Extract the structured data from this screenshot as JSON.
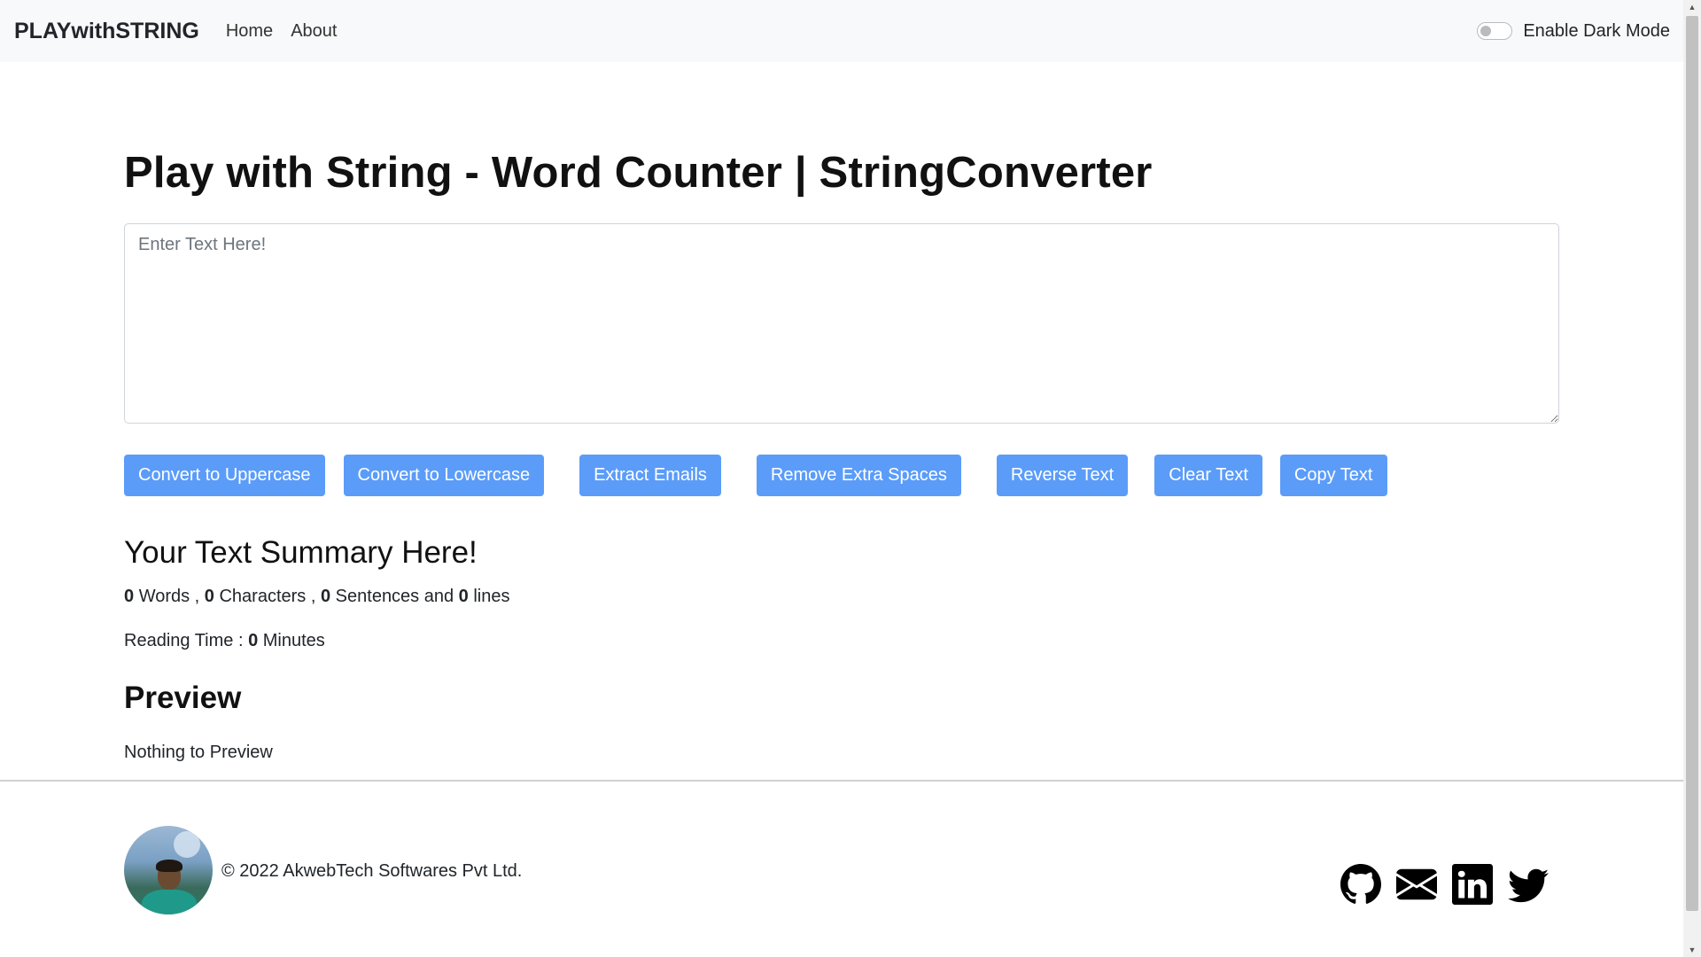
{
  "navbar": {
    "brand": "PLAYwithSTRING",
    "links": [
      "Home",
      "About"
    ],
    "dark_mode_label": "Enable Dark Mode"
  },
  "main": {
    "title": "Play with String - Word Counter | StringConverter",
    "textarea_placeholder": "Enter Text Here!",
    "textarea_value": "",
    "buttons": [
      "Convert to Uppercase",
      "Convert to Lowercase",
      "Extract Emails",
      "Remove Extra Spaces",
      "Reverse Text",
      "Clear Text",
      "Copy Text"
    ],
    "summary": {
      "heading": "Your Text Summary Here!",
      "words_count": "0",
      "words_label": "Words ,",
      "characters_count": "0",
      "characters_label": "Characters ,",
      "sentences_count": "0",
      "sentences_label": "Sentences and",
      "lines_count": "0",
      "lines_label": "lines",
      "reading_time_label": "Reading Time :",
      "reading_time_value": "0",
      "reading_time_unit": "Minutes"
    },
    "preview": {
      "heading": "Preview",
      "text": "Nothing to Preview"
    }
  },
  "footer": {
    "copyright": "© 2022 AkwebTech Softwares Pvt Ltd.",
    "social_icons": [
      "github-icon",
      "envelope-icon",
      "linkedin-icon",
      "twitter-icon"
    ]
  },
  "colors": {
    "button_bg": "#5b9cf9",
    "navbar_bg": "#f8f9fa"
  }
}
